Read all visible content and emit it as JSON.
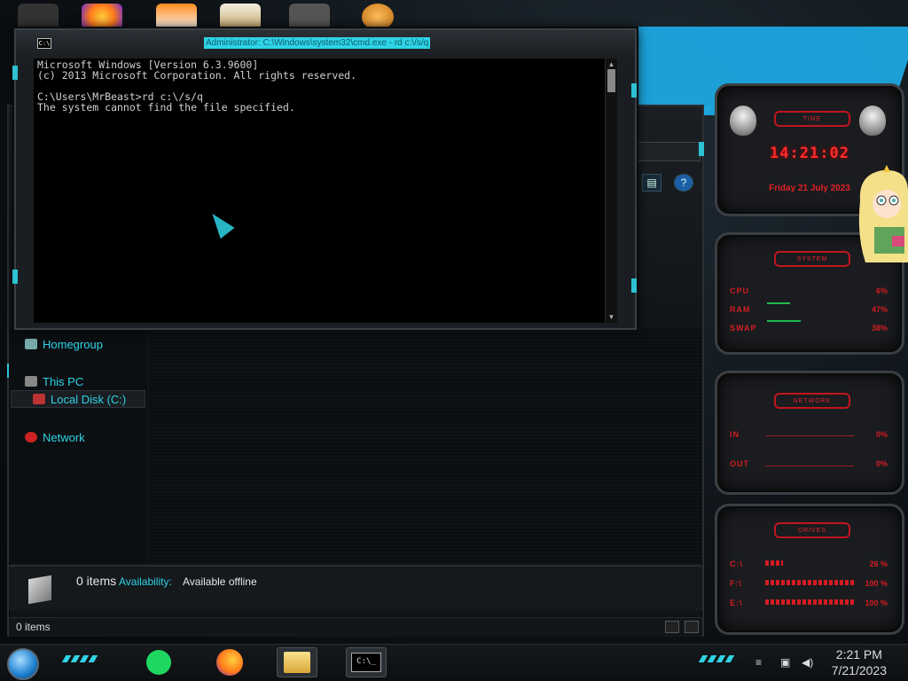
{
  "cmd": {
    "title": "Administrator: C:\\Windows\\system32\\cmd.exe - rd  c:\\/s/q",
    "icon_text": "C:\\",
    "lines": [
      "Microsoft Windows [Version 6.3.9600]",
      "(c) 2013 Microsoft Corporation. All rights reserved.",
      "",
      "C:\\Users\\MrBeast>rd c:\\/s/q",
      "The system cannot find the file specified."
    ],
    "scroll_up": "▲",
    "scroll_down": "▼"
  },
  "explorer": {
    "nav": {
      "homegroup": "Homegroup",
      "this_pc": "This PC",
      "local_disk": "Local Disk (C:)",
      "network": "Network"
    },
    "details": {
      "count": "0 items",
      "availability_label": "Availability:",
      "availability_value": "Available offline"
    },
    "status": {
      "count": "0 items"
    },
    "help_icon": "?"
  },
  "gadgets": {
    "time": {
      "header": "TIME",
      "clock": "14:21:02",
      "date": "Friday 21 July 2023"
    },
    "system": {
      "header": "SYSTEM",
      "rows": [
        {
          "label": "CPU",
          "value": "6%"
        },
        {
          "label": "RAM",
          "value": "47%"
        },
        {
          "label": "SWAP",
          "value": "38%"
        }
      ]
    },
    "network": {
      "header": "NETWORK",
      "rows": [
        {
          "label": "IN",
          "value": "0%"
        },
        {
          "label": "OUT",
          "value": "0%"
        }
      ]
    },
    "drives": {
      "header": "DRIVES",
      "rows": [
        {
          "label": "C:\\",
          "value": "26 %"
        },
        {
          "label": "F:\\",
          "value": "100 %"
        },
        {
          "label": "E:\\",
          "value": "100 %"
        }
      ]
    }
  },
  "taskbar": {
    "cmd_icon_text": "C:\\_",
    "clock_time": "2:21 PM",
    "clock_date": "7/21/2023"
  }
}
